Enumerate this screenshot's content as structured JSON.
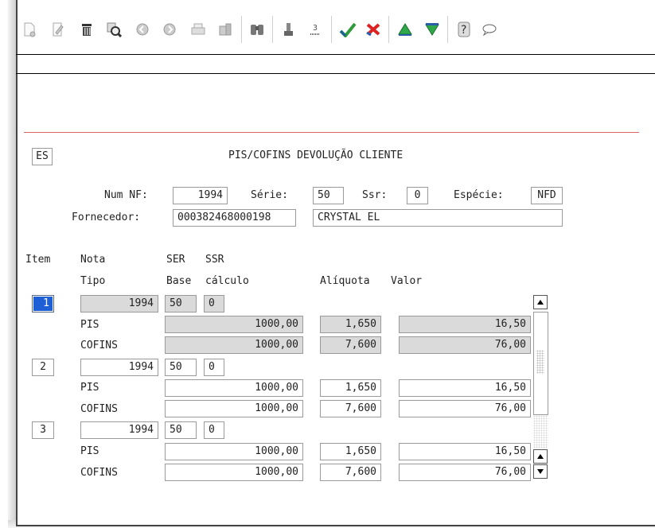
{
  "toolbar": {
    "icons": [
      "new-doc-icon",
      "edit-icon",
      "trash-icon",
      "search-icon",
      "prev-icon",
      "next-icon",
      "print-icon",
      "export-icon",
      "binoculars-icon",
      "first-icon",
      "last-icon",
      "confirm-icon",
      "cancel-icon",
      "up-icon",
      "down-icon",
      "help-icon",
      "comment-icon"
    ]
  },
  "form": {
    "tag": "ES",
    "title": "PIS/COFINS DEVOLUÇÃO CLIENTE",
    "num_nf_label": "Num NF:",
    "num_nf": "1994",
    "serie_label": "Série:",
    "serie": "50",
    "ssr_label": "Ssr:",
    "ssr": "0",
    "especie_label": "Espécie:",
    "especie": "NFD",
    "fornecedor_label": "Fornecedor:",
    "fornecedor_code": "000382468000198",
    "fornecedor_name": "CRYSTAL EL"
  },
  "headers": {
    "item": "Item",
    "nota": "Nota",
    "ser": "SER",
    "ssr": "SSR",
    "tipo": "Tipo",
    "base": "Base",
    "calculo": "cálculo",
    "aliquota": "Alíquota",
    "valor": "Valor"
  },
  "items": [
    {
      "item": "1",
      "nota": "1994",
      "ser": "50",
      "ssr": "0",
      "pis": {
        "tipo": "PIS",
        "base": "1000,00",
        "aliquota": "1,650",
        "valor": "16,50"
      },
      "cofins": {
        "tipo": "COFINS",
        "base": "1000,00",
        "aliquota": "7,600",
        "valor": "76,00"
      }
    },
    {
      "item": "2",
      "nota": "1994",
      "ser": "50",
      "ssr": "0",
      "pis": {
        "tipo": "PIS",
        "base": "1000,00",
        "aliquota": "1,650",
        "valor": "16,50"
      },
      "cofins": {
        "tipo": "COFINS",
        "base": "1000,00",
        "aliquota": "7,600",
        "valor": "76,00"
      }
    },
    {
      "item": "3",
      "nota": "1994",
      "ser": "50",
      "ssr": "0",
      "pis": {
        "tipo": "PIS",
        "base": "1000,00",
        "aliquota": "1,650",
        "valor": "16,50"
      },
      "cofins": {
        "tipo": "COFINS",
        "base": "1000,00",
        "aliquota": "7,600",
        "valor": "76,00"
      }
    }
  ]
}
